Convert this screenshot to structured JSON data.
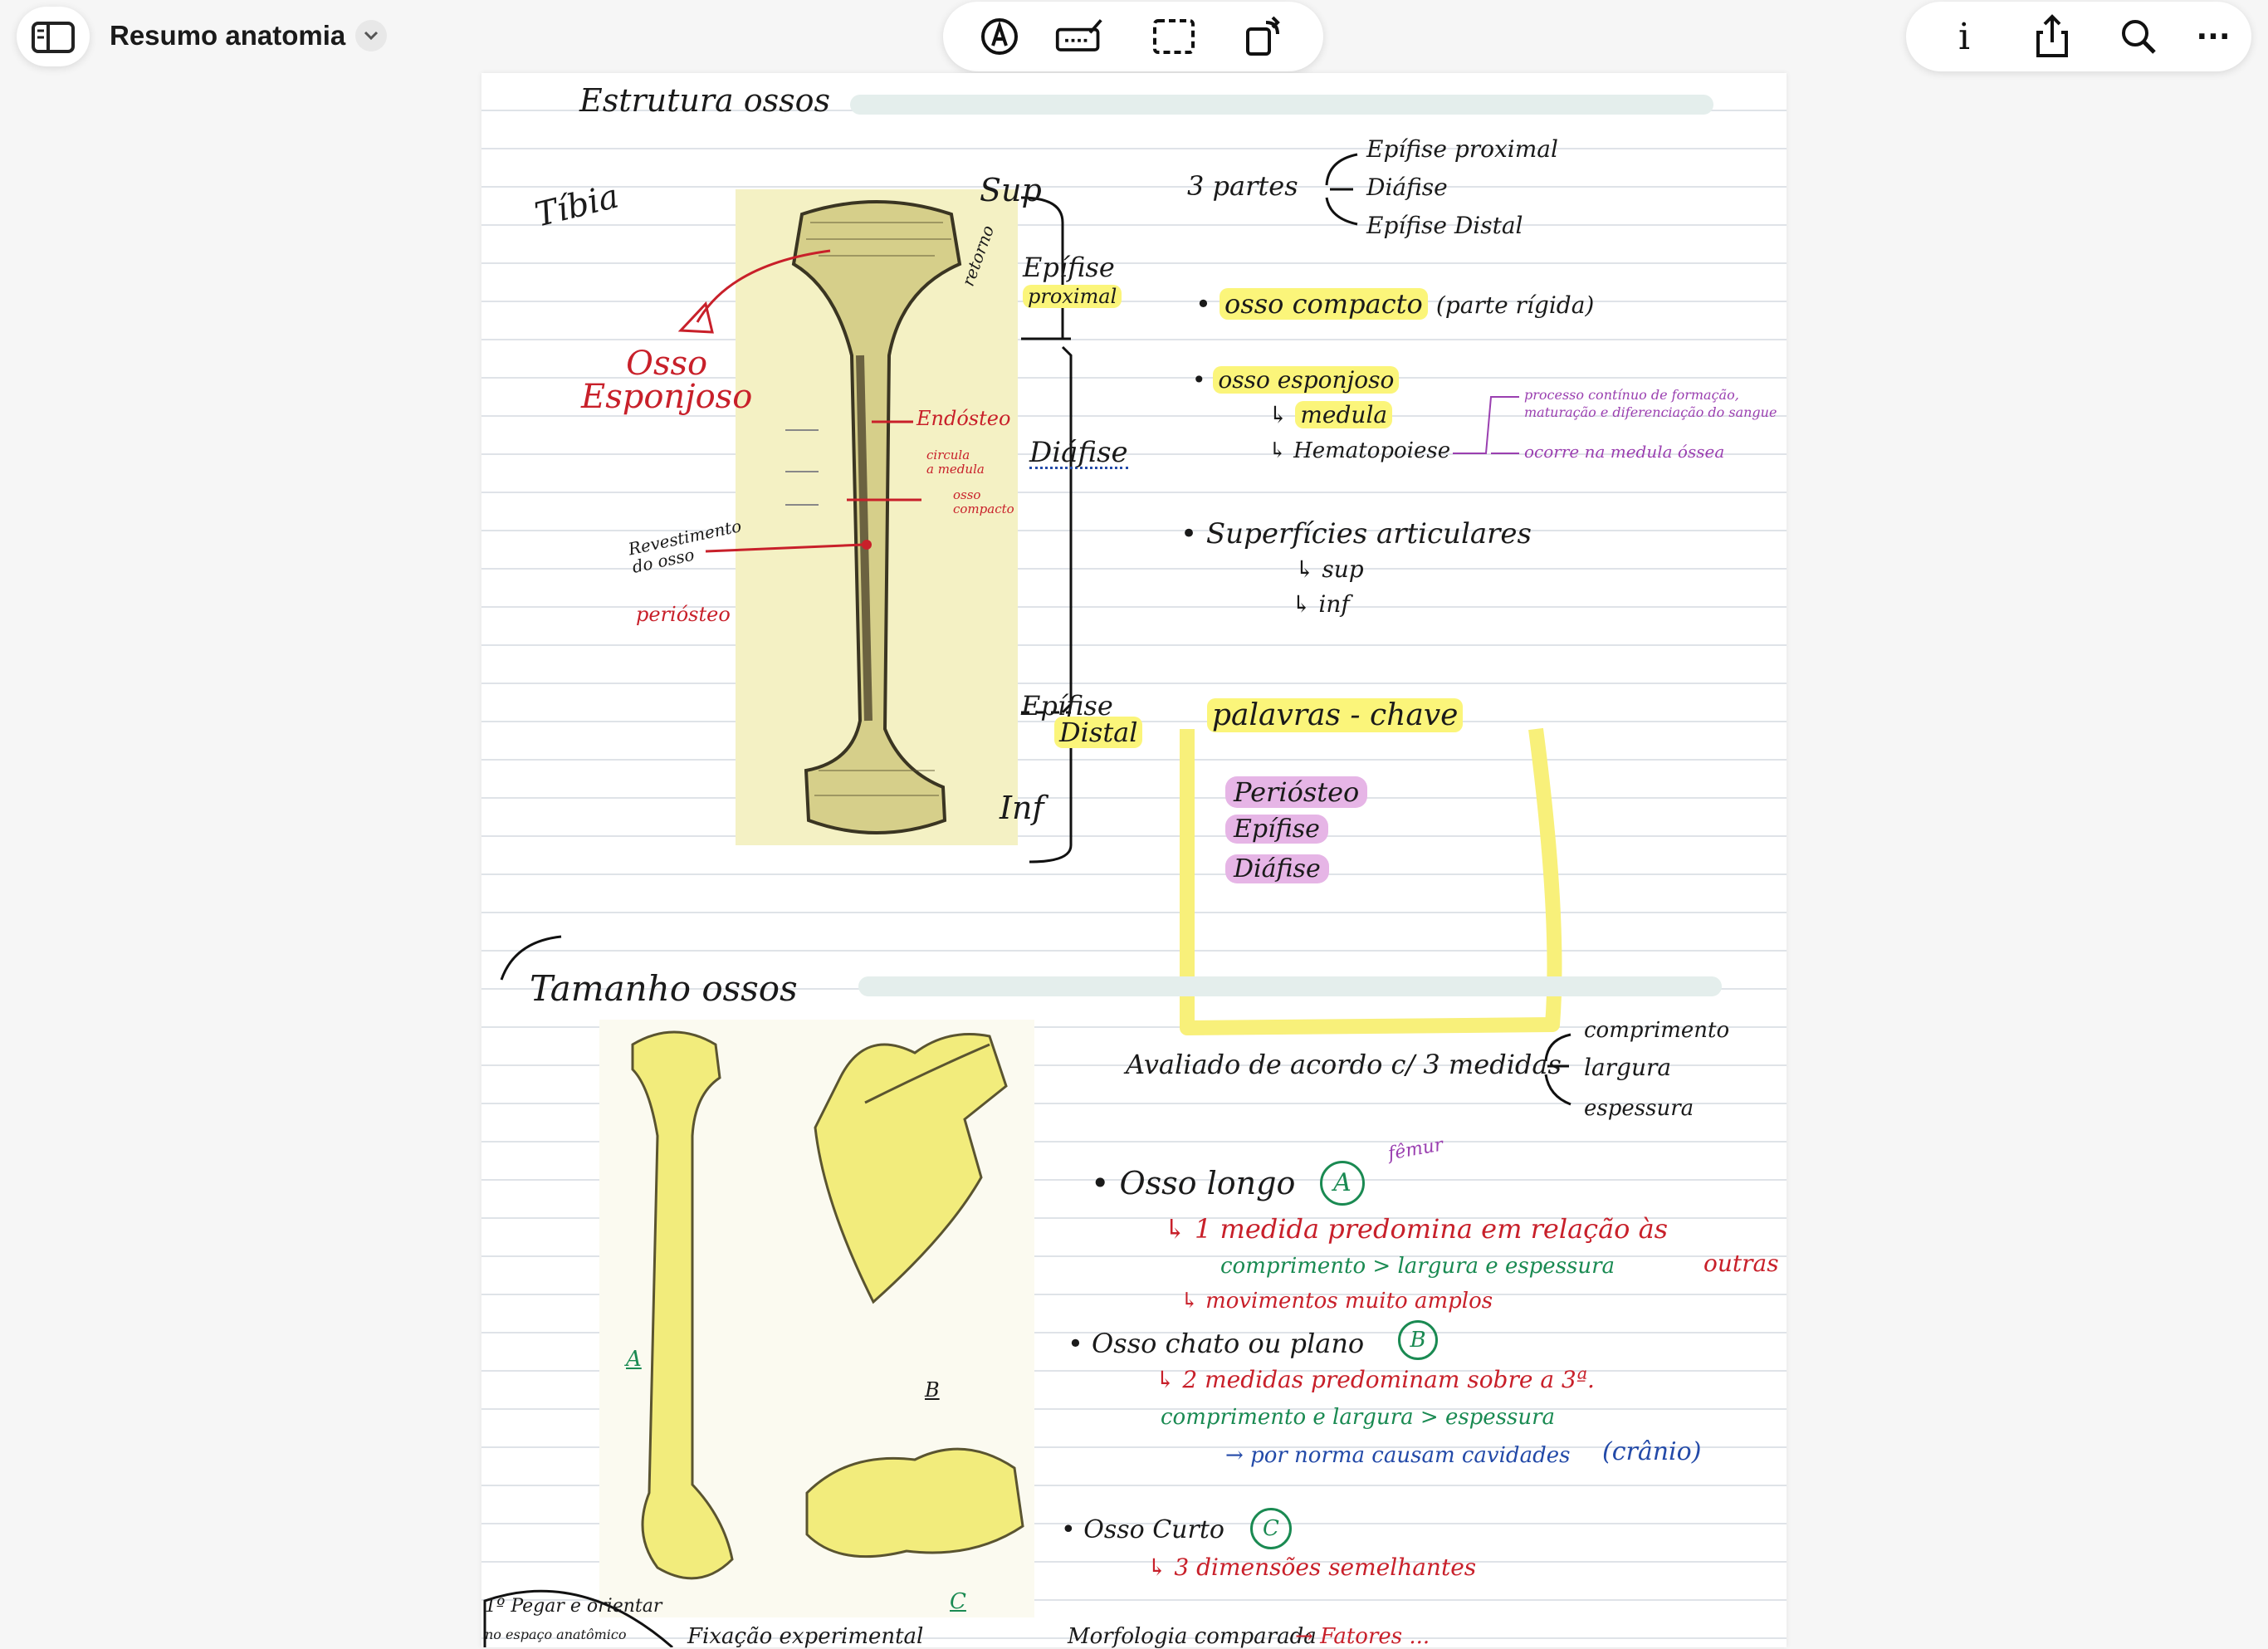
{
  "app": {
    "document_title": "Resumo anatomia"
  },
  "toolbar": {
    "left": [
      "sidebar-toggle",
      "title-menu"
    ],
    "center": [
      "pen-tool",
      "keyboard-tool",
      "lasso-select",
      "rotate-page"
    ],
    "right": [
      "info",
      "share",
      "search",
      "more"
    ],
    "info_glyph": "i",
    "more_glyph": "···"
  },
  "section1": {
    "title": "Estrutura ossos",
    "tibia": "Tíbia",
    "sup": "Sup",
    "inf": "Inf",
    "epifise_proximal": [
      "Epífise",
      "proximal"
    ],
    "diafise": "Diáfise",
    "epifise_distal": [
      "Epífise",
      "Distal"
    ],
    "osso_esponjoso": [
      "Osso",
      "Esponjoso"
    ],
    "endosteo": "Endósteo",
    "circula_medula": [
      "circula",
      "a medula"
    ],
    "osso_compacto_small": [
      "osso",
      "compacto"
    ],
    "revestimento": [
      "Revestimento",
      "do osso"
    ],
    "periosteo_small": "periósteo",
    "retorno": "retorno",
    "tres_partes": "3 partes",
    "partes": [
      "Epífise proximal",
      "Diáfise",
      "Epífise Distal"
    ],
    "osso_compacto": "osso compacto",
    "parte_rigida": "(parte rígida)",
    "osso_esponjoso_note": "osso esponjoso",
    "medula": "medula",
    "hematopoiese": "Hematopoiese",
    "processo_note": [
      "processo contínuo de formação,",
      "maturação e diferenciação do sangue"
    ],
    "ocorre_note": "ocorre na medula óssea",
    "superficies": "Superfícies articulares",
    "sup_small": "sup",
    "inf_small": "inf",
    "palavras_chave": "palavras - chave",
    "keywords": [
      "Periósteo",
      "Epífise",
      "Diáfise"
    ]
  },
  "section2": {
    "title": "Tamanho ossos",
    "avaliado": "Avaliado de acordo c/ 3 medidas",
    "medidas": [
      "comprimento",
      "largura",
      "espessura"
    ],
    "osso_longo": "Osso longo",
    "badge_a": "A",
    "femur": "fêmur",
    "longo_1": "1 medida predomina em relação às",
    "longo_outras": "outras",
    "longo_2": "comprimento > largura e espessura",
    "longo_3": "movimentos muito amplos",
    "osso_chato": "Osso chato ou plano",
    "badge_b": "B",
    "chato_1": "2 medidas predominam sobre a 3ª.",
    "chato_2": "comprimento e largura > espessura",
    "chato_3": "por norma causam cavidades",
    "chato_cranio": "(crânio)",
    "osso_curto": "Osso Curto",
    "badge_c": "C",
    "curto_1": "3 dimensões semelhantes",
    "label_a": "A",
    "label_b": "B",
    "label_c": "C",
    "footer_left": [
      "1º Pegar e orientar",
      "no espaço anatômico"
    ],
    "footer_mid": "Fixação experimental",
    "footer_right": "Morfologia comparada",
    "footer_right2": "Fatores ..."
  },
  "colors": {
    "highlight_yellow": "#fbf57a",
    "highlight_pink": "#e6b5e6",
    "red": "#c8202a",
    "green": "#1a8a52",
    "blue": "#234aa8",
    "purple": "#9a3fb0"
  }
}
